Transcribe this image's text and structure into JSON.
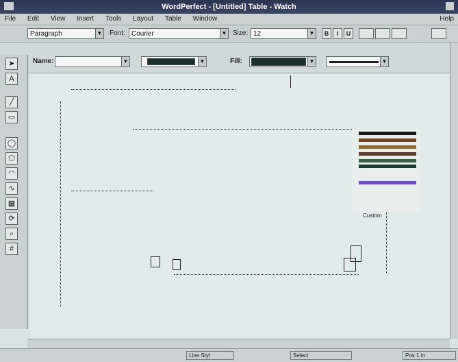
{
  "window": {
    "title": "WordPerfect - [Untitled] Table - Watch"
  },
  "menu": {
    "items": [
      "File",
      "Edit",
      "View",
      "Insert",
      "Tools",
      "Layout",
      "Table",
      "Window"
    ],
    "help": "Help"
  },
  "toolbar1": {
    "style_value": "Paragraph",
    "font_label": "Font:",
    "font_value": "Courier",
    "size_label": "Size:",
    "size_value": "12",
    "bold": "B",
    "italic": "I",
    "underline": "U"
  },
  "toolbar2": {
    "name_label": "Name:",
    "name_value": "",
    "fill_label": "Fill:",
    "fill_color": "#1d2d2b",
    "pattern_color": "#283b39"
  },
  "palette": {
    "icons": [
      "pointer-icon",
      "text-icon",
      "line-icon",
      "box-icon",
      "ellipse-icon",
      "polygon-icon",
      "arc-icon",
      "curve-icon",
      "fill-icon",
      "rotate-icon",
      "zoom-icon",
      "grid-icon"
    ]
  },
  "line_options": {
    "colors": [
      "#1a1a1a",
      "#6b4a2a",
      "#8a6a3a",
      "#5a3a2a",
      "#3a5a48",
      "#1f3a34",
      "#6d4fbf"
    ],
    "label": "Custom"
  },
  "status": {
    "panel1": "Line Styl",
    "panel2": "Select",
    "panel3": "Pos 1 in"
  }
}
